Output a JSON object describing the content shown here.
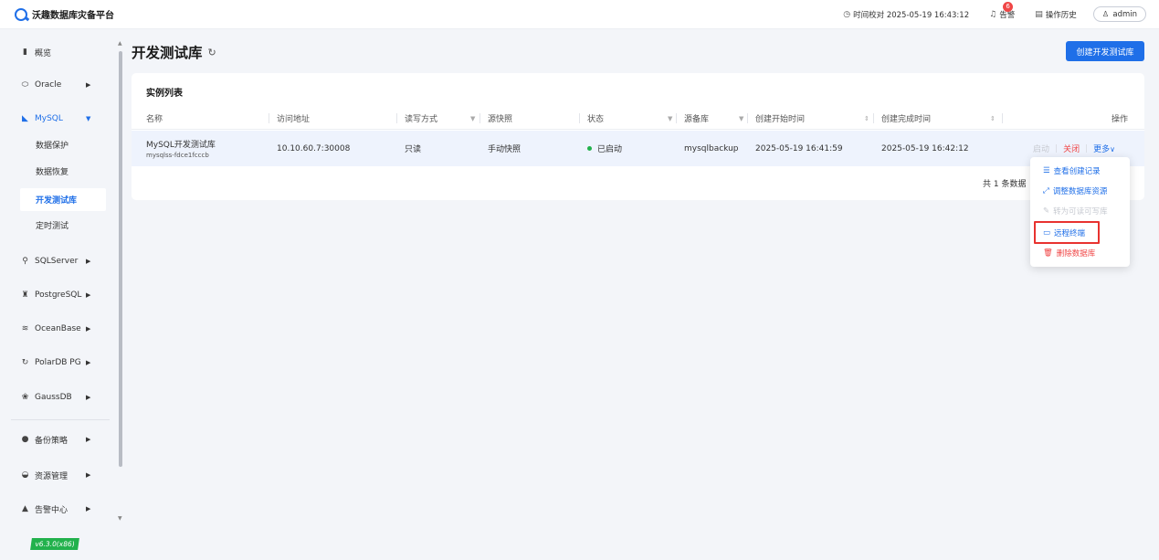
{
  "app": {
    "title": "沃趣数据库灾备平台"
  },
  "topbar": {
    "time_sync": "时间校对 2025-05-19 16:43:12",
    "alerts_label": "告警",
    "alerts_count": "6",
    "history_label": "操作历史",
    "user": "admin"
  },
  "sidebar": {
    "items": [
      {
        "label": "概览",
        "icon": "bar-chart-icon"
      },
      {
        "label": "Oracle",
        "icon": "oracle-icon"
      },
      {
        "label": "MySQL",
        "icon": "mysql-icon"
      },
      {
        "label": "SQLServer",
        "icon": "sqlserver-icon"
      },
      {
        "label": "PostgreSQL",
        "icon": "postgresql-icon"
      },
      {
        "label": "OceanBase",
        "icon": "oceanbase-icon"
      },
      {
        "label": "PolarDB PG",
        "icon": "polardb-icon"
      },
      {
        "label": "GaussDB",
        "icon": "gaussdb-icon"
      },
      {
        "label": "备份策略",
        "icon": "backup-policy-icon"
      },
      {
        "label": "资源管理",
        "icon": "resource-icon"
      },
      {
        "label": "告警中心",
        "icon": "alert-center-icon"
      }
    ],
    "mysql_sub": [
      "数据保护",
      "数据恢复",
      "开发测试库",
      "定时测试"
    ],
    "version": "v6.3.0(x86)"
  },
  "main": {
    "title": "开发测试库",
    "create_button": "创建开发测试库",
    "card_title": "实例列表",
    "columns": [
      "名称",
      "访问地址",
      "读写方式",
      "源快照",
      "状态",
      "源备库",
      "创建开始时间",
      "创建完成时间",
      "操作"
    ],
    "rows": [
      {
        "name": "MySQL开发测试库",
        "name_sub": "mysqlss-fdce1fcccb",
        "address": "10.10.60.7:30008",
        "rw_mode": "只读",
        "snapshot": "手动快照",
        "status": "已启动",
        "source": "mysqlbackup",
        "start_time": "2025-05-19 16:41:59",
        "end_time": "2025-05-19 16:42:12",
        "ops": {
          "start": "启动",
          "close": "关闭",
          "more": "更多"
        }
      }
    ],
    "total": "共 1 条数据"
  },
  "dropdown": {
    "items": [
      {
        "label": "查看创建记录",
        "icon": "list-icon"
      },
      {
        "label": "调整数据库资源",
        "icon": "resize-icon"
      },
      {
        "label": "转为可读可写库",
        "icon": "edit-icon"
      },
      {
        "label": "远程终端",
        "icon": "monitor-icon"
      },
      {
        "label": "删除数据库",
        "icon": "trash-icon"
      }
    ]
  },
  "colors": {
    "primary": "#1f6fe8",
    "danger": "#f04646",
    "success": "#22b14c",
    "highlight": "#e8322f"
  }
}
